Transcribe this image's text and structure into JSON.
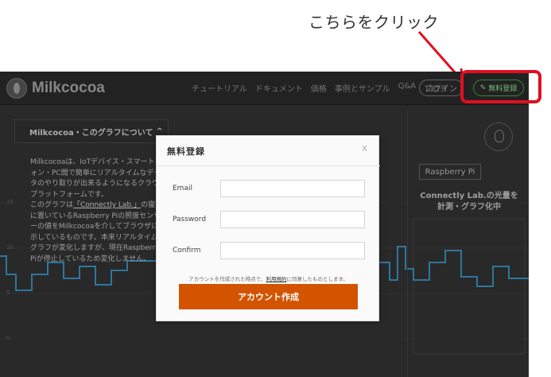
{
  "annotation": {
    "text": "こちらをクリック"
  },
  "site": {
    "logo": "Milkcocoa",
    "nav": [
      "チュートリアル",
      "ドキュメント",
      "価格",
      "事例とサンプル",
      "Q&A",
      "ブログ"
    ],
    "login_label": "ログイン",
    "signup_label": "無料登録",
    "info": {
      "title": "Milkcocoa・このグラフについて",
      "paragraph1": "Milkcocoaは、IoTデバイス・スマートフォン・PC間で簡単にリアルタイムなデータのやり取りが出来るようになるクラウドプラットフォームです。",
      "paragraph2_before": "このグラフは",
      "paragraph2_link": "「Connectly Lab.」",
      "paragraph2_after": "の寝室に置いているRaspberry Piの照度センサーの値をMilkcocoaを介してブラウザに表示しているものです。本来リアルタイムにグラフが変化しますが、現在Raspberry Piが停止しているため変化しません。"
    },
    "right": {
      "device": "Raspberry Pi",
      "title_line1": "Connectly Lab.の光量を",
      "title_line2": "計測・グラフ化中"
    },
    "chart_axis": [
      "15",
      "10",
      "5",
      "0"
    ]
  },
  "modal": {
    "title": "無料登録",
    "close": "X",
    "fields": [
      {
        "label": "Email",
        "value": ""
      },
      {
        "label": "Password",
        "value": ""
      },
      {
        "label": "Confirm",
        "value": ""
      }
    ],
    "terms_before": "アカウントを作成された時点で、",
    "terms_link": "利用規約",
    "terms_after": "に同意したものとします。",
    "submit_label": "アカウント作成"
  },
  "colors": {
    "site_bg": "#2c2c2c",
    "accent_orange": "#d35400",
    "signup_green": "#3e8e3e",
    "highlight_red": "#e01020",
    "chart_line": "#2f7fa8"
  }
}
